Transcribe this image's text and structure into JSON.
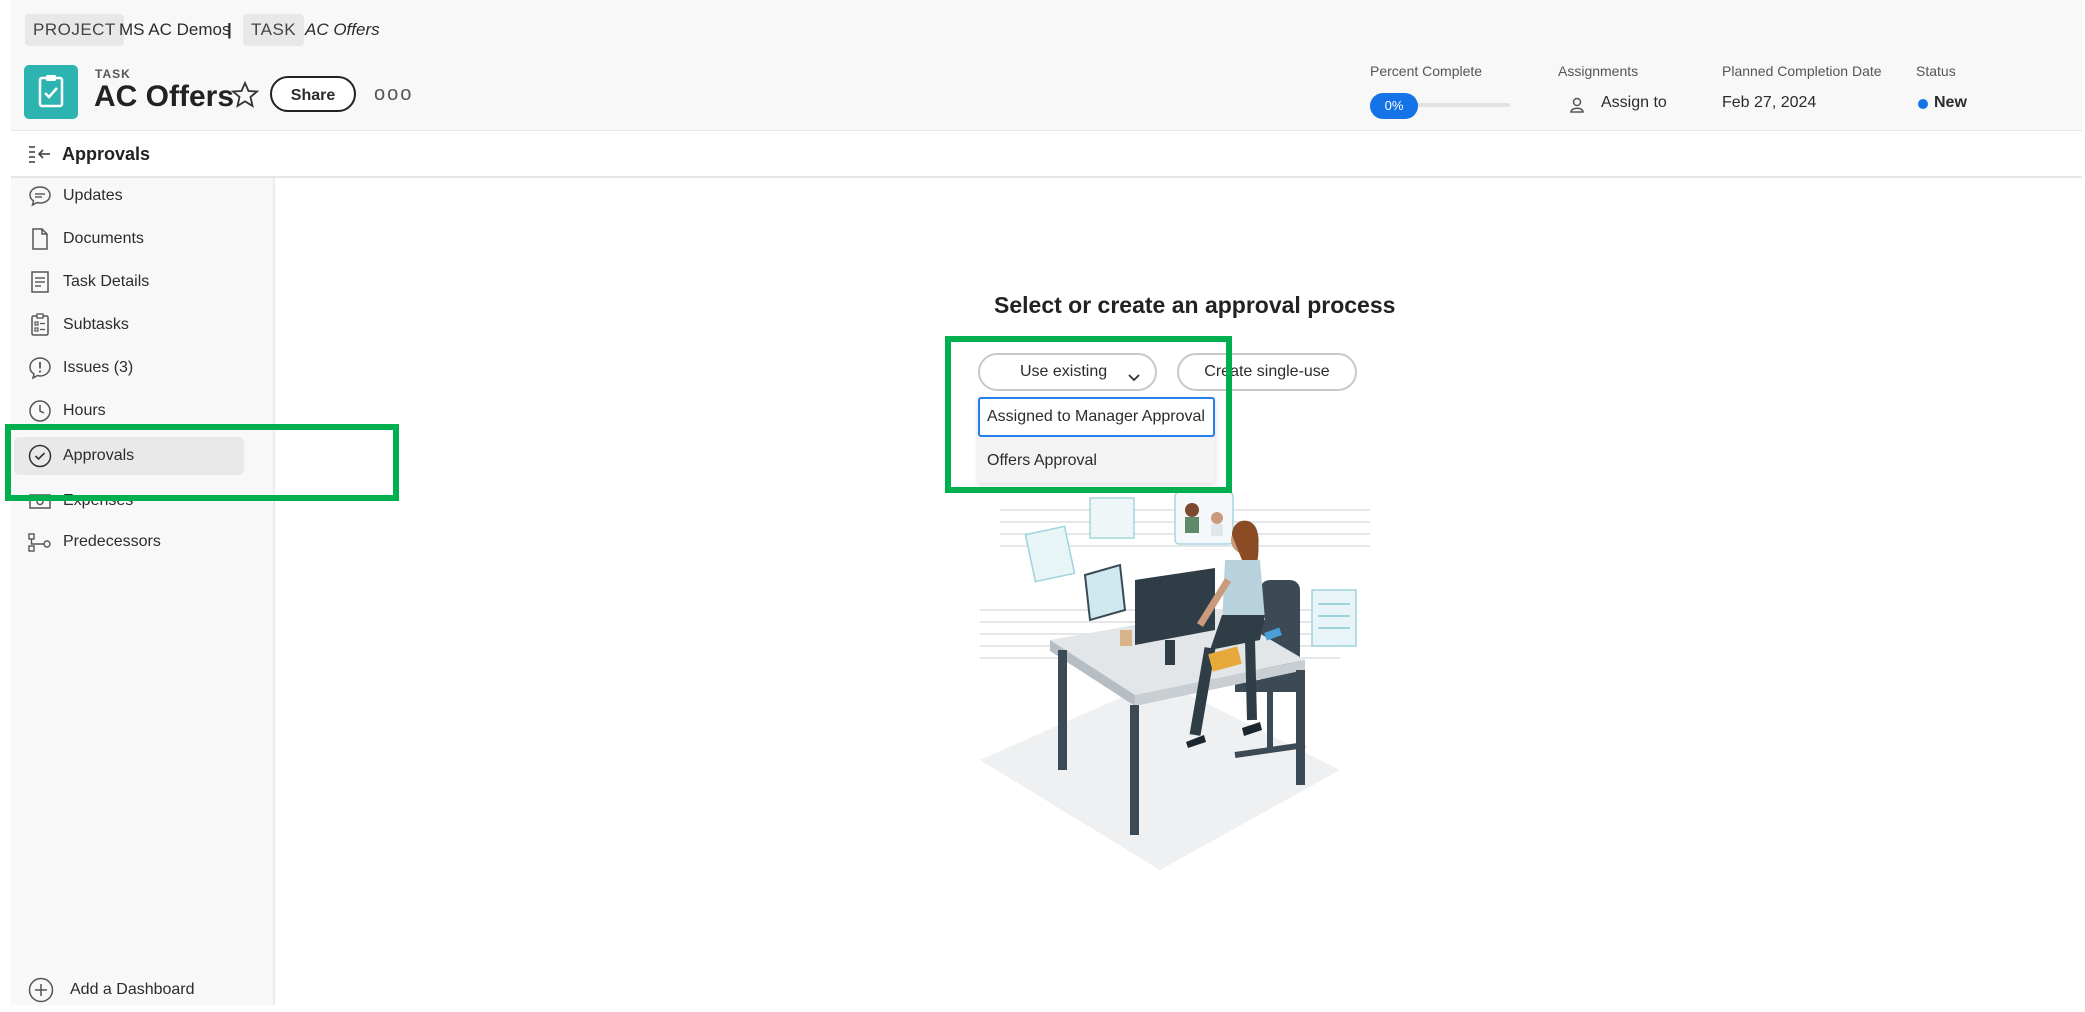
{
  "breadcrumb": {
    "project_tag": "PROJECT",
    "project_name": "MS AC Demos",
    "separator": "|",
    "task_tag": "TASK",
    "task_name": "AC Offers"
  },
  "task": {
    "eyebrow": "TASK",
    "title": "AC Offers",
    "share_label": "Share",
    "more_label": "ooo",
    "icon": "clipboard-check-icon",
    "icon_color": "#2db4b0"
  },
  "meta": {
    "percent_label": "Percent Complete",
    "percent_value": "0%",
    "percent_fraction": 0,
    "assignments_label": "Assignments",
    "assign_to": "Assign to",
    "planned_label": "Planned Completion Date",
    "planned_value": "Feb 27, 2024",
    "status_label": "Status",
    "status_value": "New",
    "status_color": "#1473e6"
  },
  "section": {
    "title": "Approvals"
  },
  "sidebar": {
    "items": [
      {
        "label": "Updates",
        "icon": "speech-bubble-icon"
      },
      {
        "label": "Documents",
        "icon": "document-icon"
      },
      {
        "label": "Task Details",
        "icon": "details-icon"
      },
      {
        "label": "Subtasks",
        "icon": "subtasks-icon"
      },
      {
        "label": "Issues (3)",
        "icon": "issue-icon"
      },
      {
        "label": "Hours",
        "icon": "clock-icon"
      },
      {
        "label": "Approvals",
        "icon": "check-circle-icon",
        "active": true
      },
      {
        "label": "Expenses",
        "icon": "money-icon"
      },
      {
        "label": "Predecessors",
        "icon": "predecessor-icon"
      }
    ],
    "add_dashboard": "Add a Dashboard"
  },
  "main": {
    "title": "Select or create an approval process",
    "use_existing": "Use existing",
    "create_single_use": "Create single-use",
    "options": [
      "Assigned to Manager Approval",
      "Offers Approval"
    ]
  },
  "colors": {
    "highlight": "#00b050",
    "accent": "#1473e6"
  }
}
